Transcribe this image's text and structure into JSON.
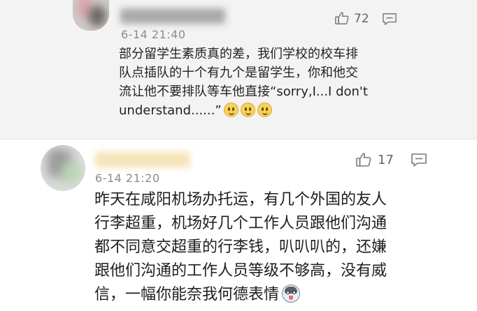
{
  "comments": [
    {
      "time": "6-14 21:40",
      "likes": "72",
      "lines": [
        "部分留学生素质真的差，我们学校的校车排",
        "队点插队的十个有九个是留学生，你和他交",
        "流让他不要排队等车他直接“sorry,I...I don't",
        "understand......”"
      ],
      "trailing_emojis": [
        "smiley-emoji",
        "smiley-emoji",
        "smiley-emoji"
      ]
    },
    {
      "time": "6-14 21:20",
      "likes": "17",
      "lines": [
        "昨天在咸阳机场办托运，有几个外国的友人",
        "行李超重，机场好几个工作人员跟他们沟通",
        "都不同意交超重的行李钱，叭叭叭的，还嫌",
        "跟他们沟通的工作人员等级不够高，没有威",
        "信，一幅你能奈我何德表情"
      ],
      "trailing_emojis": [
        "husky-emoji"
      ]
    }
  ],
  "colors": {
    "top_background": "#f3f3f3",
    "bottom_background": "#ffffff",
    "meta_text": "#8b8b8b",
    "icon_stroke": "#7a7a7a"
  }
}
